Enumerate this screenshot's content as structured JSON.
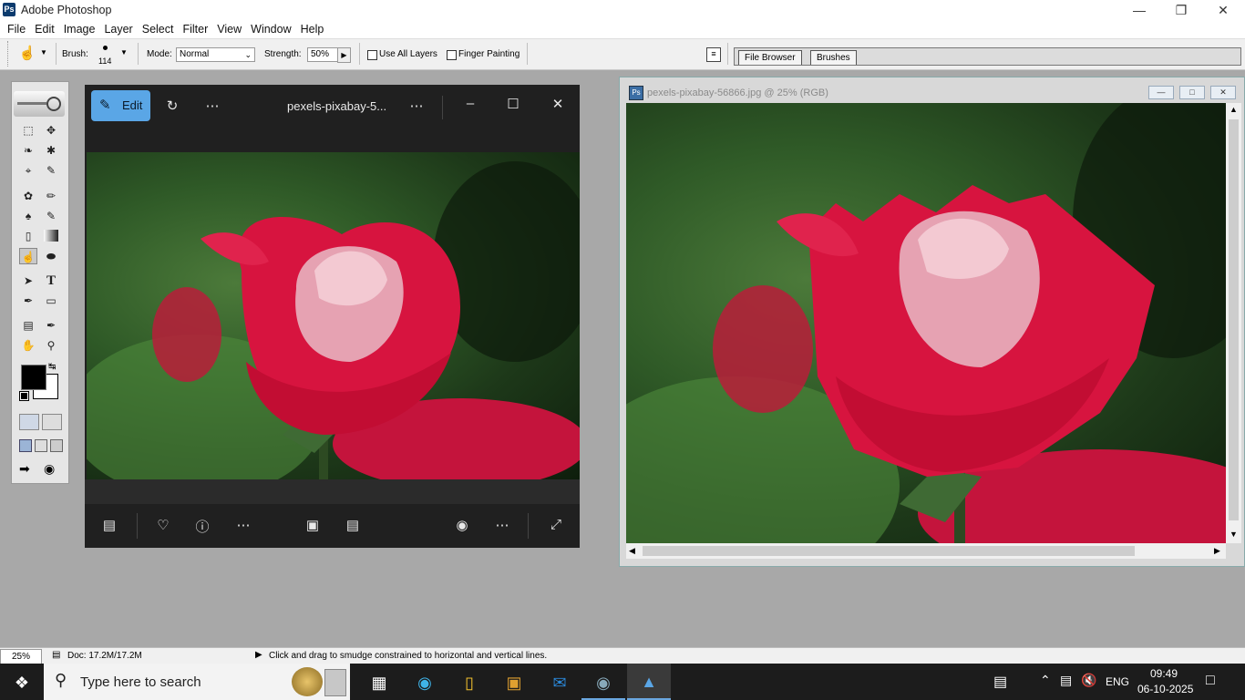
{
  "app": {
    "title": "Adobe Photoshop",
    "window_controls": [
      "minimize-icon",
      "restore-icon",
      "close-icon"
    ]
  },
  "menu": [
    "File",
    "Edit",
    "Image",
    "Layer",
    "Select",
    "Filter",
    "View",
    "Window",
    "Help"
  ],
  "options": {
    "brush_label": "Brush:",
    "brush_size": "114",
    "mode_label": "Mode:",
    "mode_value": "Normal",
    "strength_label": "Strength:",
    "strength_value": "50%",
    "use_all_layers": "Use All Layers",
    "finger_painting": "Finger Painting"
  },
  "palette_well": {
    "tabs": [
      "File Browser",
      "Brushes"
    ]
  },
  "photos_app": {
    "edit_label": "Edit",
    "file_name": "pexels-pixabay-5...",
    "more": "…"
  },
  "document": {
    "title": "pexels-pixabay-56866.jpg @ 25% (RGB)"
  },
  "status": {
    "zoom": "25%",
    "doc_size": "Doc: 17.2M/17.2M",
    "hint": "Click and drag to smudge constrained to horizontal and vertical lines."
  },
  "taskbar": {
    "search_placeholder": "Type here to search",
    "language": "ENG",
    "time": "09:49",
    "date": "06-10-2025"
  },
  "colors": {
    "accent_blue": "#5aa6e6",
    "taskbar": "#1c1c1c",
    "workspace": "#a8a8a8"
  }
}
